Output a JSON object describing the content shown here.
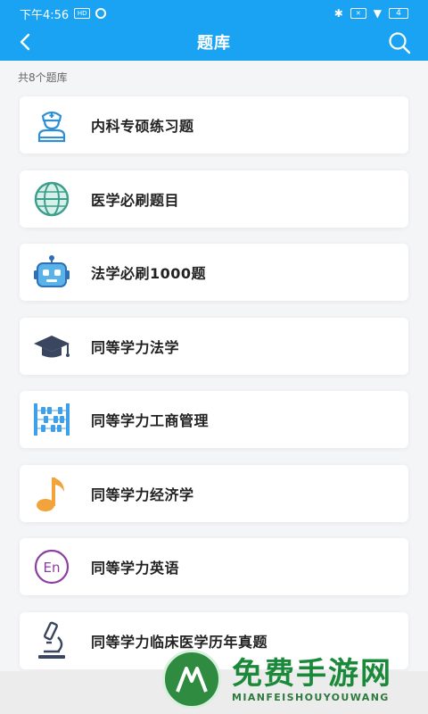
{
  "status_bar": {
    "time": "下午4:56",
    "badge_text": "HD",
    "battery": "4"
  },
  "header": {
    "title": "题库",
    "back_icon": "chevron-left-icon",
    "search_icon": "search-icon",
    "color": "#1aa3f3"
  },
  "count_text": "共8个题库",
  "items": [
    {
      "label": "内科专硕练习题",
      "icon": "nurse-icon"
    },
    {
      "label": "医学必刷题目",
      "icon": "globe-icon"
    },
    {
      "label": "法学必刷1000题",
      "icon": "robot-icon"
    },
    {
      "label": "同等学力法学",
      "icon": "graduation-cap-icon"
    },
    {
      "label": "同等学力工商管理",
      "icon": "abacus-icon"
    },
    {
      "label": "同等学力经济学",
      "icon": "music-note-icon"
    },
    {
      "label": "同等学力英语",
      "icon": "en-icon"
    },
    {
      "label": "同等学力临床医学历年真题",
      "icon": "microscope-icon"
    }
  ],
  "watermark": {
    "cn": "免费手游网",
    "en": "MIANFEISHOUYOUWANG"
  }
}
